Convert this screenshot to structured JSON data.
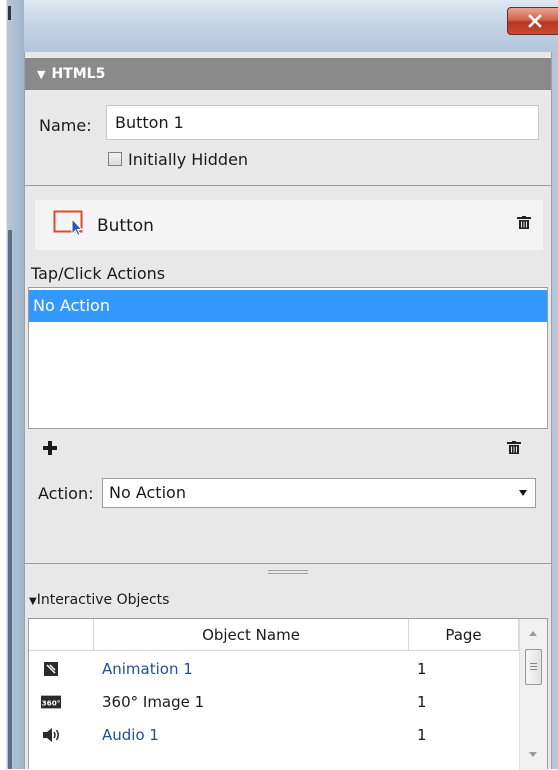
{
  "window": {
    "close_label": "close"
  },
  "section": {
    "title": "HTML5"
  },
  "name_field": {
    "label": "Name:",
    "value": "Button 1"
  },
  "initially_hidden": {
    "label": "Initially Hidden",
    "checked": false
  },
  "button_row": {
    "title": "Button",
    "icon": "button-icon"
  },
  "tap_actions": {
    "label": "Tap/Click Actions",
    "items": [
      "No Action"
    ]
  },
  "action": {
    "label": "Action:",
    "selected": "No Action"
  },
  "interactive_objects": {
    "header": "Interactive Objects",
    "columns": [
      "Object Name",
      "Page"
    ],
    "rows": [
      {
        "icon": "animation-icon",
        "name": "Animation 1",
        "page": "1"
      },
      {
        "icon": "360-image-icon",
        "icon_text": "360°",
        "name": "360° Image 1",
        "page": "1"
      },
      {
        "icon": "audio-icon",
        "name": "Audio 1",
        "page": "1"
      }
    ]
  },
  "colors": {
    "selection": "#3399ff",
    "header": "#8a8a8a",
    "accent": "#e04a2a",
    "link": "#1f4f9e"
  }
}
